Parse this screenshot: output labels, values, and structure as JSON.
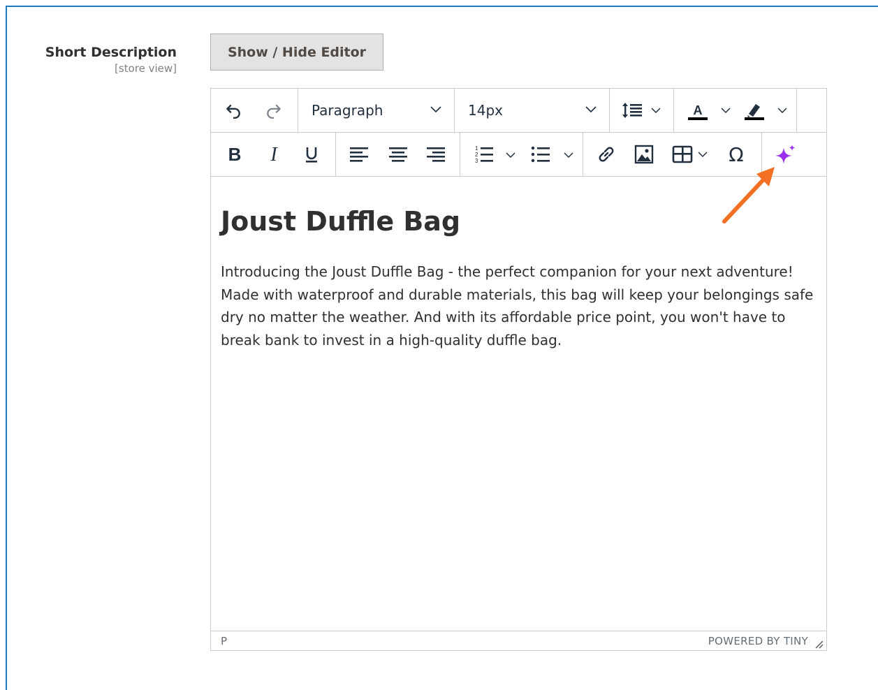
{
  "field": {
    "label": "Short Description",
    "scope": "[store view]"
  },
  "toggle_button": {
    "label": "Show / Hide Editor"
  },
  "toolbar": {
    "block_format": "Paragraph",
    "font_size": "14px",
    "icons": [
      "undo-icon",
      "redo-icon",
      "line-height-icon",
      "text-color-icon",
      "highlight-color-icon",
      "bold-icon",
      "italic-icon",
      "underline-icon",
      "align-left-icon",
      "align-center-icon",
      "align-right-icon",
      "numbered-list-icon",
      "bullet-list-icon",
      "link-icon",
      "image-icon",
      "table-icon",
      "special-character-icon",
      "ai-assistant-icon"
    ]
  },
  "content": {
    "heading": "Joust Duffle Bag",
    "paragraph": "Introducing the Joust Duffle Bag - the perfect companion for your next adventure! Made with waterproof and durable materials, this bag will keep your belongings safe dry no matter the weather. And with its affordable price point, you won't have to break bank to invest in a high-quality duffle bag."
  },
  "statusbar": {
    "path": "P",
    "brand": "POWERED BY TINY"
  },
  "colors": {
    "frame_border": "#1a7bbf",
    "ai_icon": "#9b30ef",
    "arrow": "#f27024"
  }
}
